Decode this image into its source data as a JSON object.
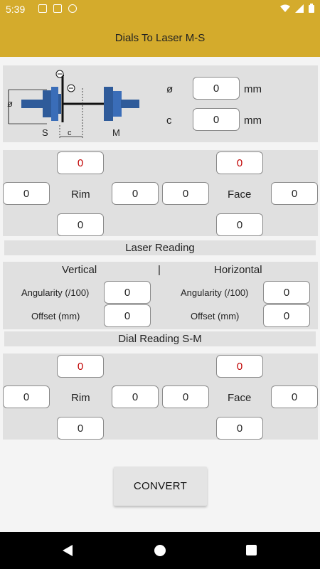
{
  "status": {
    "time": "5:39"
  },
  "app": {
    "title": "Dials To Laser M-S"
  },
  "inputs": {
    "diameter_label": "ø",
    "diameter_value": "0",
    "diameter_unit": "mm",
    "c_label": "c",
    "c_value": "0",
    "c_unit": "mm"
  },
  "diagram": {
    "label_s": "S",
    "label_m": "M",
    "label_c": "c",
    "label_dia": "ø"
  },
  "dial_top": {
    "rim_label": "Rim",
    "face_label": "Face",
    "rim_top": "0",
    "rim_left": "0",
    "rim_right": "0",
    "rim_bottom": "0",
    "face_top": "0",
    "face_left": "0",
    "face_right": "0",
    "face_bottom": "0"
  },
  "laser": {
    "header": "Laser Reading",
    "vertical_label": "Vertical",
    "separator": "|",
    "horizontal_label": "Horizontal",
    "angularity_label": "Angularity (/100)",
    "offset_label": "Offset (mm)",
    "v_angularity": "0",
    "v_offset": "0",
    "h_angularity": "0",
    "h_offset": "0"
  },
  "dial_bottom": {
    "header": "Dial Reading S-M",
    "rim_label": "Rim",
    "face_label": "Face",
    "rim_top": "0",
    "rim_left": "0",
    "rim_right": "0",
    "rim_bottom": "0",
    "face_top": "0",
    "face_left": "0",
    "face_right": "0",
    "face_bottom": "0"
  },
  "convert_label": "CONVERT",
  "colors": {
    "accent": "#d4ab2c",
    "panel": "#e0e0e0",
    "red_value": "#c00000",
    "shaft_blue": "#2f5b9a"
  }
}
